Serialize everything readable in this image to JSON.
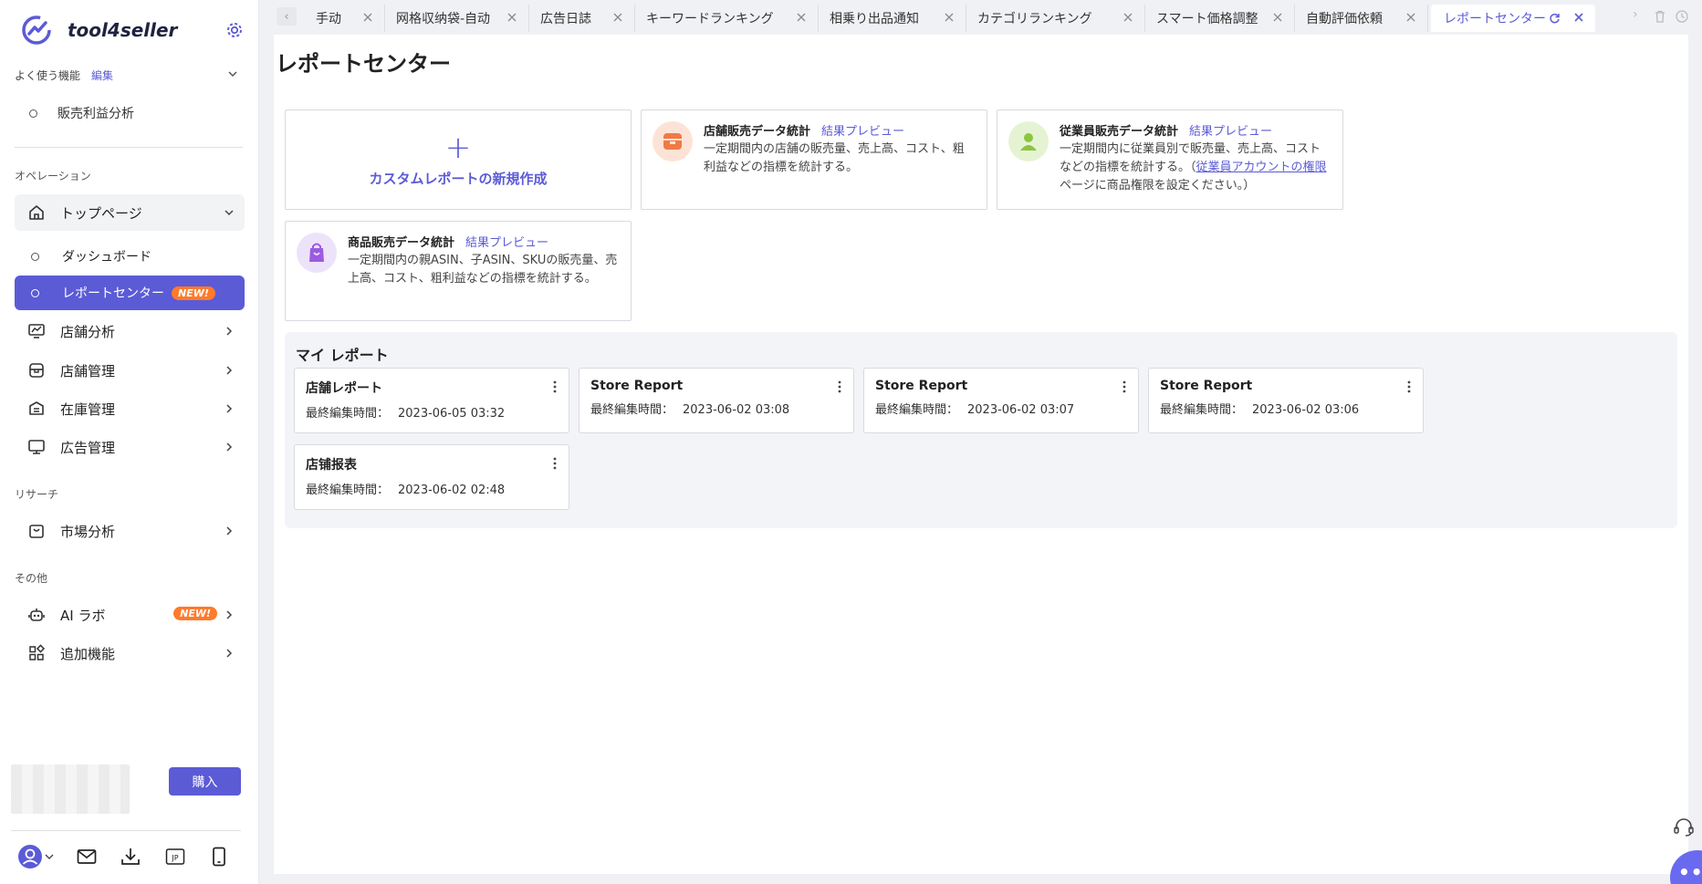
{
  "app": {
    "name": "tool4seller"
  },
  "sidebar": {
    "favorites_label": "よく使う機能",
    "favorites_edit": "編集",
    "favorites_items": [
      {
        "label": "販売利益分析"
      }
    ],
    "section_operations": "オペレーション",
    "top_page": "トップページ",
    "top_children": [
      {
        "label": "ダッシュボード"
      },
      {
        "label": "レポートセンター",
        "badge": "NEW!"
      }
    ],
    "nav_ops": [
      {
        "label": "店舗分析"
      },
      {
        "label": "店舗管理"
      },
      {
        "label": "在庫管理"
      },
      {
        "label": "広告管理"
      }
    ],
    "section_research": "リサーチ",
    "nav_research": [
      {
        "label": "市場分析"
      }
    ],
    "section_other": "その他",
    "nav_other": [
      {
        "label": "AI ラボ",
        "badge": "NEW!"
      },
      {
        "label": "追加機能"
      }
    ],
    "buy_label": "購入",
    "lang_label": "JP"
  },
  "tabs": [
    {
      "label": "手动"
    },
    {
      "label": "网格収纳袋-自动"
    },
    {
      "label": "広告日誌"
    },
    {
      "label": "キーワードランキング"
    },
    {
      "label": "相乗り出品通知"
    },
    {
      "label": "カテゴリランキング"
    },
    {
      "label": "スマート価格調整"
    },
    {
      "label": "自動評価依頼"
    },
    {
      "label": "レポートセンター",
      "active": true
    }
  ],
  "main": {
    "title": "レポートセンター",
    "new_custom": "カスタムレポートの新規作成",
    "templates": [
      {
        "title": "店舗販売データ統計",
        "preview": "結果プレビュー",
        "desc": "一定期間内の店舗の販売量、売上高、コスト、粗利益などの指標を統計する。"
      },
      {
        "title": "従業員販売データ統計",
        "preview": "結果プレビュー",
        "desc_before": "一定期間内に従業員別で販売量、売上高、コストなどの指標を統計する。（",
        "desc_link": "従業員アカウントの権限",
        "desc_after": "ページに商品権限を設定ください。）"
      },
      {
        "title": "商品販売データ統計",
        "preview": "結果プレビュー",
        "desc": "一定期間内の親ASIN、子ASIN、SKUの販売量、売上高、コスト、粗利益などの指標を統計する。"
      }
    ],
    "my_reports_title": "マイ レポート",
    "edited_label": "最終編集時間：",
    "reports": [
      {
        "name": "店舗レポート",
        "edited": "2023-06-05 03:32"
      },
      {
        "name": "Store Report",
        "edited": "2023-06-02 03:08"
      },
      {
        "name": "Store Report",
        "edited": "2023-06-02 03:07"
      },
      {
        "name": "Store Report",
        "edited": "2023-06-02 03:06"
      },
      {
        "name": "店铺报表",
        "edited": "2023-06-02 02:48"
      }
    ]
  },
  "colors": {
    "accent": "#5b5bd6",
    "badge": "#ff7a2a"
  }
}
